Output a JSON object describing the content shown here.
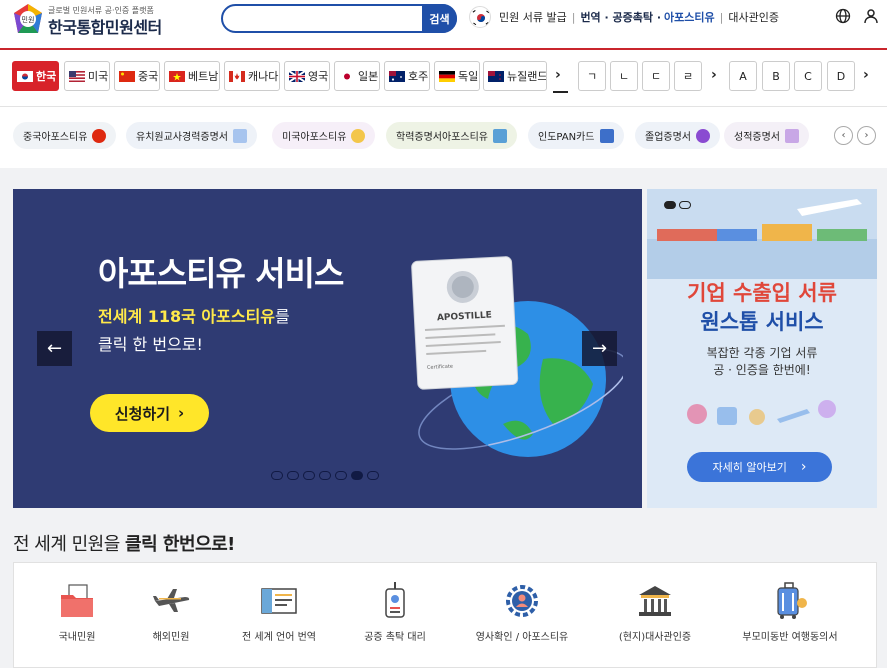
{
  "header": {
    "logo_sub": "글로벌 민원서류 공·인증 플랫폼",
    "logo_name": "한국통합민원센터",
    "logo_badge": "민원",
    "search_placeholder": "",
    "search_button": "검색",
    "nav": {
      "doc_issue": "민원 서류 발급",
      "trans": "번역 · 공증촉탁 ·",
      "apostille": "아포스티유",
      "embassy": "대사관인증"
    },
    "icons": [
      "globe-icon",
      "user-icon"
    ]
  },
  "countries": [
    {
      "label": "한국",
      "icon": "korea-flag"
    },
    {
      "label": "미국",
      "icon": "usa-flag"
    },
    {
      "label": "중국",
      "icon": "china-flag"
    },
    {
      "label": "베트남",
      "icon": "vietnam-flag"
    },
    {
      "label": "캐나다",
      "icon": "canada-flag"
    },
    {
      "label": "영국",
      "icon": "uk-flag"
    },
    {
      "label": "일본",
      "icon": "japan-flag"
    },
    {
      "label": "호주",
      "icon": "australia-flag"
    },
    {
      "label": "독일",
      "icon": "germany-flag"
    },
    {
      "label": "뉴질랜드",
      "icon": "newzealand-flag"
    }
  ],
  "korean_index": [
    "ㄱ",
    "ㄴ",
    "ㄷ",
    "ㄹ"
  ],
  "alpha_index": [
    "A",
    "B",
    "C",
    "D"
  ],
  "chips": [
    {
      "label": "중국아포스티유",
      "bg": "#f0f3f6"
    },
    {
      "label": "유치원교사경력증명서",
      "bg": "#eef2f8"
    },
    {
      "label": "미국아포스티유",
      "bg": "#f6eff8"
    },
    {
      "label": "학력증명서아포스티유",
      "bg": "#eef3e5"
    },
    {
      "label": "인도PAN카드",
      "bg": "#eef2f8"
    },
    {
      "label": "졸업증명서",
      "bg": "#eef2f8"
    },
    {
      "label": "성적증명서",
      "bg": "#f4f0f7"
    }
  ],
  "hero": {
    "title": "아포스티유 서비스",
    "line1_pre": "전세계 118국 아포스티유",
    "line1_post": "를",
    "line2": "클릭 한 번으로!",
    "apply": "신청하기",
    "doc_title": "APOSTILLE",
    "doc_caption": "Certificate",
    "active_slide_index": 5,
    "slide_count": 7
  },
  "side_banner": {
    "line1": "기업 수출입 서류",
    "line2": "원스톱 서비스",
    "line3": "복잡한 각종 기업 서류",
    "line4": "공 · 인증을 한번에!",
    "more": "자세히 알아보기"
  },
  "section": {
    "title_pre": "전 세계 민원을 ",
    "title_bold": "클릭 한번으로",
    "title_end": "!"
  },
  "services": [
    {
      "label": "국내민원",
      "icon": "folder-doc-icon"
    },
    {
      "label": "해외민원",
      "icon": "airplane-icon"
    },
    {
      "label": "전 세계 언어 번역",
      "icon": "ticket-doc-icon"
    },
    {
      "label": "공증 촉탁 대리",
      "icon": "badge-tag-icon"
    },
    {
      "label": "영사확인 / 아포스티유",
      "icon": "gear-person-icon"
    },
    {
      "label": "(현지)대사관인증",
      "icon": "embassy-icon"
    },
    {
      "label": "부모미동반 여행동의서",
      "icon": "luggage-icon"
    }
  ],
  "colors": {
    "accent": "#1f4fa8",
    "brand_red": "#d8232a",
    "hero_bg": "#2f3b73",
    "cta": "#ffe629"
  }
}
